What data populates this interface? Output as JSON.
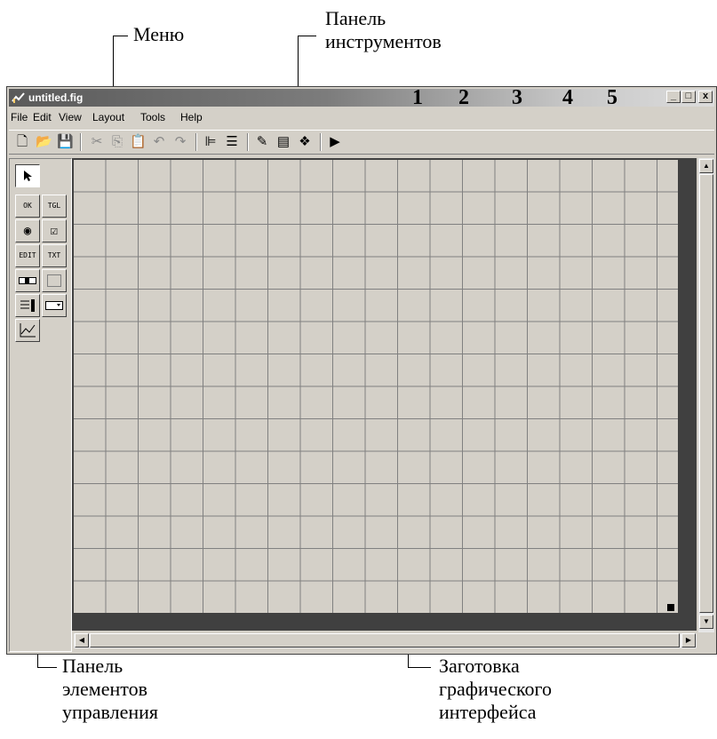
{
  "annotations": {
    "menu": "Меню",
    "toolbar_line1": "Панель",
    "toolbar_line2": "инструментов",
    "palette_line1": "Панель",
    "palette_line2": "элементов",
    "palette_line3": "управления",
    "canvas_line1": "Заготовка",
    "canvas_line2": "графического",
    "canvas_line3": "интерфейса"
  },
  "window": {
    "title": "untitled.fig",
    "numbers": [
      "1",
      "2",
      "3",
      "4",
      "5"
    ],
    "controls": {
      "minimize": "_",
      "maximize": "□",
      "close": "x"
    }
  },
  "menu": {
    "items": [
      "File",
      "Edit",
      "View",
      "Layout",
      "Tools",
      "Help"
    ]
  },
  "toolbar": {
    "buttons": [
      {
        "icon": "new-file-icon",
        "glyph": "🗋"
      },
      {
        "icon": "open-folder-icon",
        "glyph": "📂"
      },
      {
        "icon": "save-icon",
        "glyph": "💾"
      },
      {
        "icon": "cut-icon",
        "glyph": "✂"
      },
      {
        "icon": "copy-icon",
        "glyph": "⎘"
      },
      {
        "icon": "paste-icon",
        "glyph": "📋"
      },
      {
        "icon": "undo-icon",
        "glyph": "↶"
      },
      {
        "icon": "redo-icon",
        "glyph": "↷"
      },
      {
        "icon": "align-icon",
        "glyph": "⊫"
      },
      {
        "icon": "menu-editor-icon",
        "glyph": "☰"
      },
      {
        "icon": "property-inspector-icon",
        "glyph": "✎"
      },
      {
        "icon": "mfile-editor-icon",
        "glyph": "▤"
      },
      {
        "icon": "object-browser-icon",
        "glyph": "❖"
      },
      {
        "icon": "run-icon",
        "glyph": "▶"
      }
    ]
  },
  "palette": {
    "labels": {
      "pushbutton": "OK",
      "toggle": "TGL",
      "edit": "EDIT",
      "text": "TXT"
    }
  },
  "colors": {
    "window_face": "#d4d0c8",
    "canvas_border": "#404040",
    "grid": "#808080"
  }
}
